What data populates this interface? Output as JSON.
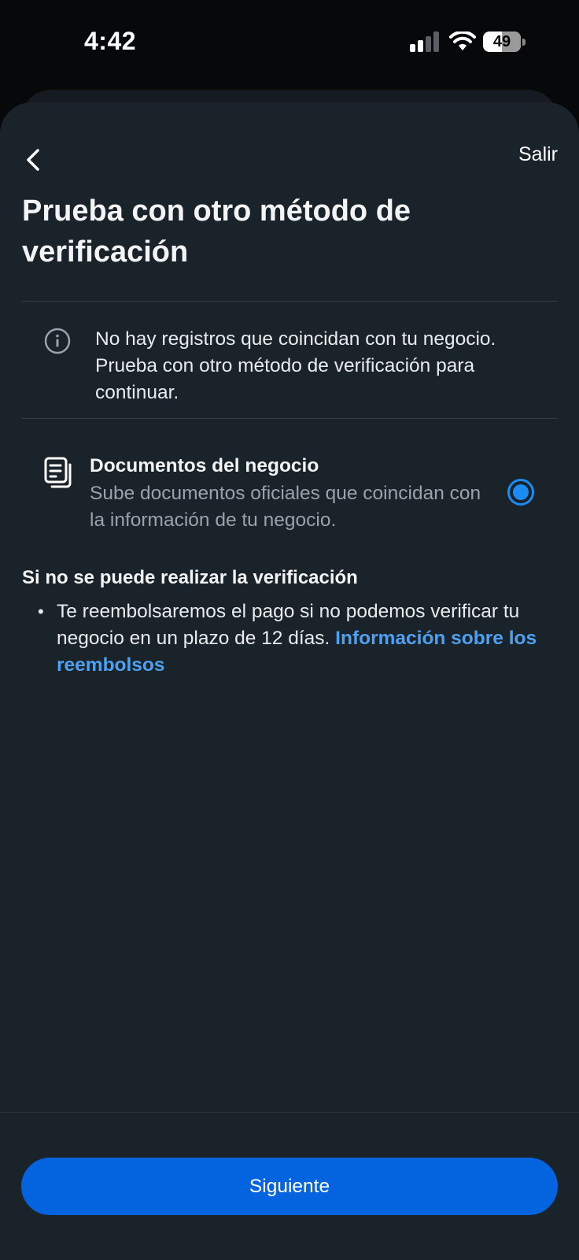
{
  "status_bar": {
    "time": "4:42",
    "battery_level": "49",
    "signal_icon": "cellular-signal-icon",
    "wifi_icon": "wifi-icon",
    "battery_icon": "battery-icon"
  },
  "header": {
    "back_icon": "chevron-left-icon",
    "exit_label": "Salir"
  },
  "page": {
    "title": "Prueba con otro método de verificación"
  },
  "notice": {
    "icon": "info-icon",
    "text": "No hay registros que coincidan con tu negocio. Prueba con otro método de verificación para continuar."
  },
  "option": {
    "icon": "document-icon",
    "title": "Documentos del negocio",
    "description": "Sube documentos oficiales que coincidan con la información de tu negocio.",
    "selected": true
  },
  "refund_section": {
    "heading": "Si no se puede realizar la verificación",
    "bullet_text": "Te reembolsaremos el pago si no podemos verificar tu negocio en un plazo de 12 días.",
    "link_text": "Información sobre los reembolsos"
  },
  "footer": {
    "next_label": "Siguiente"
  },
  "colors": {
    "background": "#1a222a",
    "accent": "#0464e0",
    "link": "#4ea1f0",
    "radio": "#1c8cf5"
  }
}
